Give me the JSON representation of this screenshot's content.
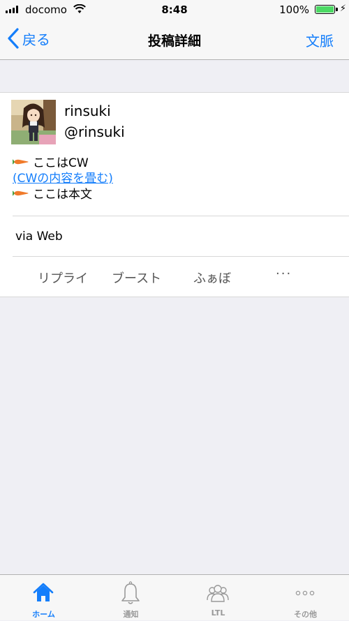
{
  "status_bar": {
    "carrier": "docomo",
    "time": "8:48",
    "battery": "100%",
    "battery_level": 1.0
  },
  "nav": {
    "back_label": "戻る",
    "title": "投稿詳細",
    "context_label": "文脈"
  },
  "post": {
    "display_name": "rinsuki",
    "acct": "@rinsuki",
    "cw_text": "ここはCW",
    "cw_toggle": "(CWの内容を畳む)",
    "body_text": "ここは本文",
    "emoji_icon": "carrot-icon",
    "via": "via Web"
  },
  "actions": {
    "reply": "リプライ",
    "boost": "ブースト",
    "fav": "ふぁぼ",
    "more": "···"
  },
  "tabs": [
    {
      "label": "ホーム",
      "icon": "home-icon",
      "active": true
    },
    {
      "label": "通知",
      "icon": "bell-icon",
      "active": false
    },
    {
      "label": "LTL",
      "icon": "people-icon",
      "active": false
    },
    {
      "label": "その他",
      "icon": "more-dots-icon",
      "active": false
    }
  ],
  "colors": {
    "accent": "#147efb",
    "background": "#efeff4",
    "inactive": "#999999",
    "battery": "#4cd964"
  }
}
